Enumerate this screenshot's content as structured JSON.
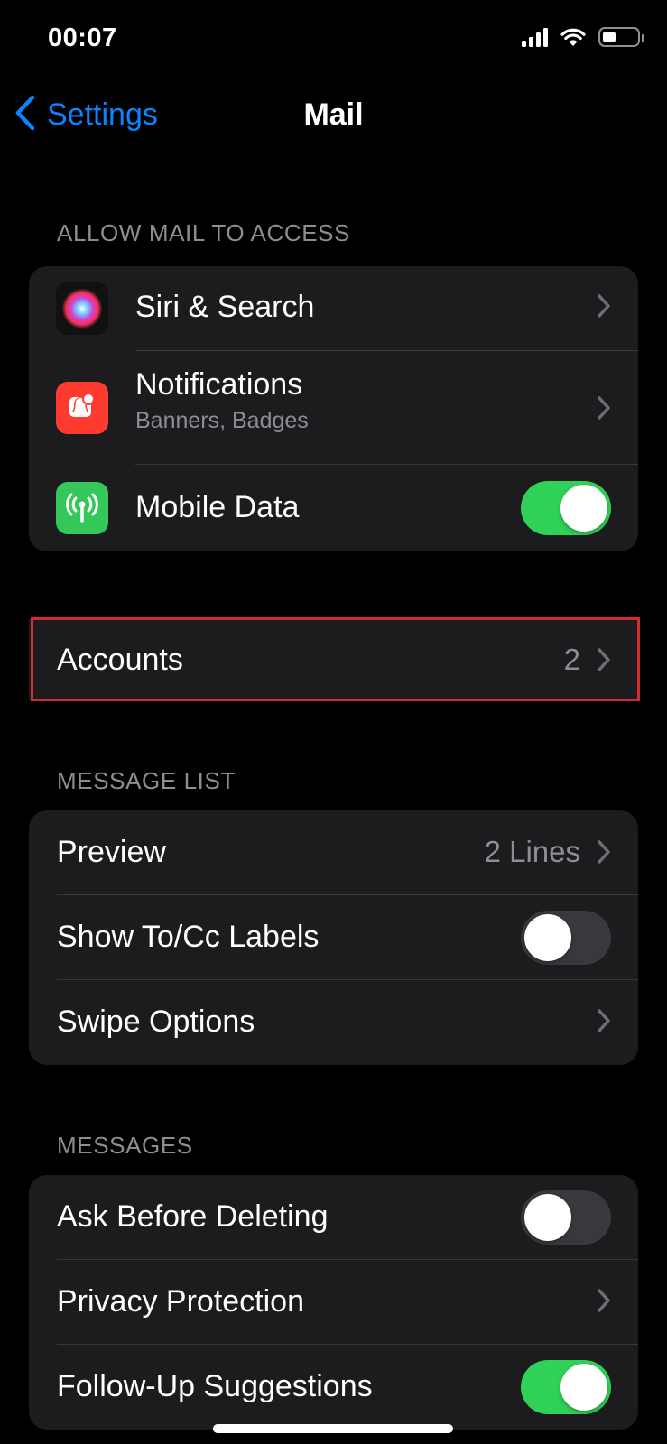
{
  "status_bar": {
    "time": "00:07"
  },
  "nav": {
    "back_label": "Settings",
    "title": "Mail"
  },
  "sections": {
    "allow_access": {
      "header": "ALLOW MAIL TO ACCESS",
      "rows": [
        {
          "label": "Siri & Search",
          "icon": "siri-icon"
        },
        {
          "label": "Notifications",
          "sublabel": "Banners, Badges",
          "icon": "notifications-icon",
          "icon_color": "#ff3b30"
        },
        {
          "label": "Mobile Data",
          "icon": "antenna-icon",
          "icon_color": "#34c759",
          "toggle": true
        }
      ]
    },
    "accounts": {
      "label": "Accounts",
      "value": "2"
    },
    "message_list": {
      "header": "MESSAGE LIST",
      "rows": [
        {
          "label": "Preview",
          "value": "2 Lines"
        },
        {
          "label": "Show To/Cc Labels",
          "toggle": false
        },
        {
          "label": "Swipe Options"
        }
      ]
    },
    "messages": {
      "header": "MESSAGES",
      "rows": [
        {
          "label": "Ask Before Deleting",
          "toggle": false
        },
        {
          "label": "Privacy Protection"
        },
        {
          "label": "Follow-Up Suggestions",
          "toggle": true
        }
      ]
    }
  },
  "colors": {
    "accent": "#0a84ff",
    "toggle_on": "#30d158",
    "highlight": "#d32b33",
    "group_bg": "#1c1c1e"
  }
}
